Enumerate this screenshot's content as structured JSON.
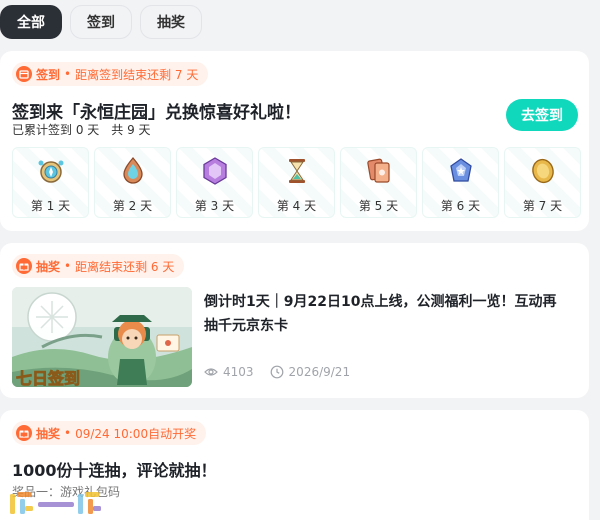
{
  "tabs": [
    {
      "label": "全部",
      "active": true
    },
    {
      "label": "签到",
      "active": false
    },
    {
      "label": "抽奖",
      "active": false
    }
  ],
  "checkin": {
    "tag_type": "签到",
    "tag_text": "距离签到结束还剩 7 天",
    "title": "签到来「永恒庄园」兑换惊喜好礼啦！",
    "accumulated": "已累计签到 0 天",
    "total": "共 9 天",
    "button_label": "去签到",
    "days": [
      {
        "label": "第 1 天",
        "icon": "compass-icon"
      },
      {
        "label": "第 2 天",
        "icon": "water-drop-gem-icon"
      },
      {
        "label": "第 3 天",
        "icon": "hexagon-crystal-icon"
      },
      {
        "label": "第 4 天",
        "icon": "hourglass-icon"
      },
      {
        "label": "第 5 天",
        "icon": "cards-icon"
      },
      {
        "label": "第 6 天",
        "icon": "blue-crystal-icon"
      },
      {
        "label": "第 7 天",
        "icon": "gold-coin-icon"
      }
    ]
  },
  "lottery1": {
    "tag_type": "抽奖",
    "tag_text": "距离结束还剩 6 天",
    "title": "倒计时1天｜9月22日10点上线，公测福利一览！互动再抽千元京东卡",
    "views": "4103",
    "date": "2026/9/21"
  },
  "lottery2": {
    "tag_type": "抽奖",
    "tag_text": "09/24 10:00自动开奖",
    "title": "1000份十连抽，评论就抽！",
    "prize": "奖品一：游戏礼包码"
  },
  "colors": {
    "accent": "#10d8bd",
    "tag_orange": "#ff6a35",
    "tag_bg": "#fff2ec",
    "active_tab": "#2b2f36"
  }
}
